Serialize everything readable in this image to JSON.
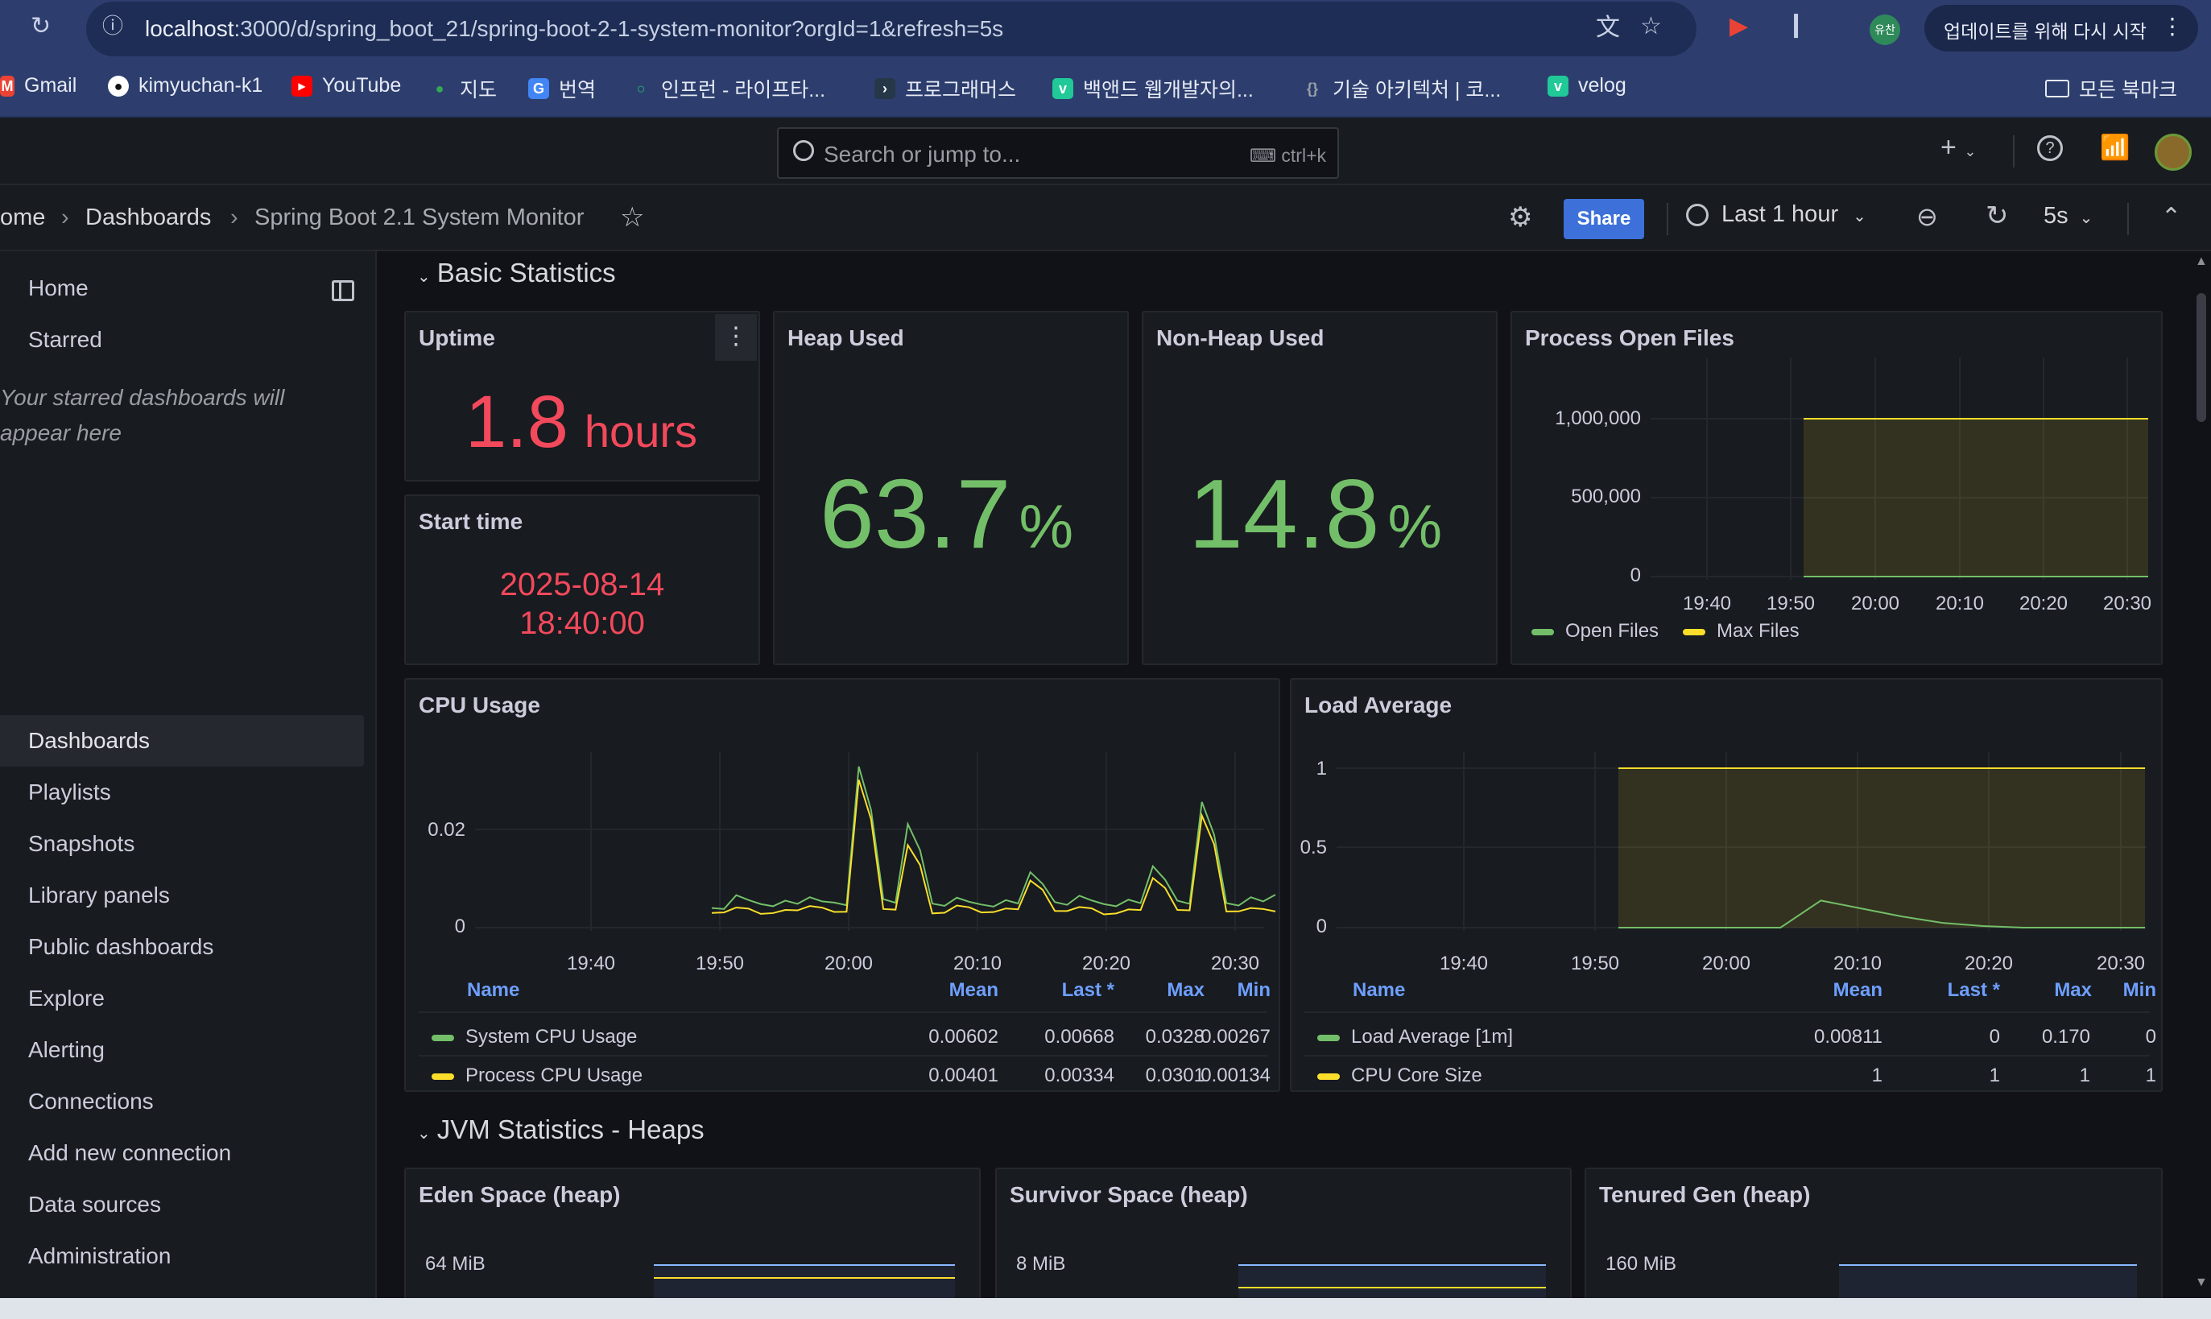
{
  "browser": {
    "url_host": "localhost",
    "url_path": ":3000/d/spring_boot_21/spring-boot-2-1-system-monitor?orgId=1&refresh=5s",
    "profile_label": "유찬",
    "update_label": "업데이트를 위해 다시 시작"
  },
  "bookmarks": [
    {
      "label": "Gmail",
      "color": "#ea4335",
      "icon": "gmail-icon"
    },
    {
      "label": "kimyuchan-k1",
      "color": "#ffffff",
      "icon": "github-icon"
    },
    {
      "label": "YouTube",
      "color": "#ff0000",
      "icon": "youtube-icon"
    },
    {
      "label": "지도",
      "color": "#34a853",
      "icon": "maps-icon"
    },
    {
      "label": "번역",
      "color": "#4285f4",
      "icon": "translate-icon"
    },
    {
      "label": "인프런 - 라이프타...",
      "color": "#1dc078",
      "icon": "inflearn-icon"
    },
    {
      "label": "프로그래머스",
      "color": "#263747",
      "icon": "programmers-icon"
    },
    {
      "label": "백앤드 웹개발자의...",
      "color": "#20c997",
      "icon": "velog-icon"
    },
    {
      "label": "기술 아키텍처 | 코...",
      "color": "#9aa0a6",
      "icon": "code-icon"
    },
    {
      "label": "velog",
      "color": "#20c997",
      "icon": "velog-icon"
    }
  ],
  "bookmarks_folder": "모든 북마크",
  "topnav": {
    "search_placeholder": "Search or jump to...",
    "search_shortcut": "ctrl+k"
  },
  "breadcrumb": {
    "home": "ome",
    "dashboards": "Dashboards",
    "current": "Spring Boot 2.1 System Monitor"
  },
  "toolbar": {
    "share_label": "Share",
    "time_range": "Last 1 hour",
    "refresh_interval": "5s"
  },
  "sidebar": {
    "items": [
      {
        "label": "Home"
      },
      {
        "label": "Starred"
      },
      {
        "label": "Dashboards"
      },
      {
        "label": "Playlists"
      },
      {
        "label": "Snapshots"
      },
      {
        "label": "Library panels"
      },
      {
        "label": "Public dashboards"
      },
      {
        "label": "Explore"
      },
      {
        "label": "Alerting"
      },
      {
        "label": "Connections"
      },
      {
        "label": "Add new connection"
      },
      {
        "label": "Data sources"
      },
      {
        "label": "Administration"
      }
    ],
    "starred_note": "Your starred dashboards will appear here"
  },
  "rows": {
    "basic": "Basic Statistics",
    "jvm_heaps": "JVM Statistics - Heaps"
  },
  "colors": {
    "green": "#73bf69",
    "yellow": "#fade2a",
    "red": "#f2495c",
    "blue": "#8ab8ff"
  },
  "panels": {
    "uptime": {
      "title": "Uptime",
      "value": "1.8",
      "unit": "hours"
    },
    "start_time": {
      "title": "Start time",
      "date": "2025-08-14",
      "time": "18:40:00"
    },
    "heap_used": {
      "title": "Heap Used",
      "value": "63.7",
      "unit": "%"
    },
    "non_heap_used": {
      "title": "Non-Heap Used",
      "value": "14.8",
      "unit": "%"
    },
    "open_files": {
      "title": "Process Open Files",
      "y_ticks": [
        "1,000,000",
        "500,000",
        "0"
      ],
      "x_ticks": [
        "19:40",
        "19:50",
        "20:00",
        "20:10",
        "20:20",
        "20:30"
      ],
      "legend": [
        "Open Files",
        "Max Files"
      ]
    },
    "cpu": {
      "title": "CPU Usage",
      "y_ticks": [
        "0.02",
        "0"
      ],
      "x_ticks": [
        "19:40",
        "19:50",
        "20:00",
        "20:10",
        "20:20",
        "20:30"
      ],
      "table_headers": [
        "Name",
        "Mean",
        "Last *",
        "Max",
        "Min"
      ],
      "rows": [
        {
          "name": "System CPU Usage",
          "mean": "0.00602",
          "last": "0.00668",
          "max": "0.0328",
          "min": "0.00267"
        },
        {
          "name": "Process CPU Usage",
          "mean": "0.00401",
          "last": "0.00334",
          "max": "0.0301",
          "min": "0.00134"
        }
      ]
    },
    "load": {
      "title": "Load Average",
      "y_ticks": [
        "1",
        "0.5",
        "0"
      ],
      "x_ticks": [
        "19:40",
        "19:50",
        "20:00",
        "20:10",
        "20:20",
        "20:30"
      ],
      "table_headers": [
        "Name",
        "Mean",
        "Last *",
        "Max",
        "Min"
      ],
      "rows": [
        {
          "name": "Load Average [1m]",
          "mean": "0.00811",
          "last": "0",
          "max": "0.170",
          "min": "0"
        },
        {
          "name": "CPU Core Size",
          "mean": "1",
          "last": "1",
          "max": "1",
          "min": "1"
        }
      ]
    },
    "eden": {
      "title": "Eden Space (heap)",
      "y_tick": "64 MiB"
    },
    "survivor": {
      "title": "Survivor Space (heap)",
      "y_tick": "8 MiB"
    },
    "tenured": {
      "title": "Tenured Gen (heap)",
      "y_tick": "160 MiB"
    }
  },
  "chart_data": [
    {
      "type": "area",
      "title": "Process Open Files",
      "x": [
        "19:53",
        "20:33"
      ],
      "series": [
        {
          "name": "Open Files",
          "values": [
            0,
            0
          ]
        },
        {
          "name": "Max Files",
          "values": [
            1048576,
            1048576
          ]
        }
      ],
      "ylim": [
        0,
        1048576
      ]
    },
    {
      "type": "line",
      "title": "CPU Usage",
      "x": [
        "19:53",
        "20:33"
      ],
      "series": [
        {
          "name": "System CPU Usage",
          "values": [
            0.004,
            0.0066,
            0.0048,
            0.0055,
            0.0062,
            0.0051,
            0.0328,
            0.0058,
            0.0211,
            0.0049,
            0.0061,
            0.0047,
            0.0056,
            0.0113,
            0.0052,
            0.0065,
            0.0048,
            0.0057,
            0.0125,
            0.0055,
            0.0256,
            0.005,
            0.0062,
            0.0067
          ]
        },
        {
          "name": "Process CPU Usage",
          "values": [
            0.003,
            0.0041,
            0.0028,
            0.0036,
            0.0044,
            0.0032,
            0.0301,
            0.0038,
            0.0168,
            0.0029,
            0.0045,
            0.0031,
            0.0039,
            0.0096,
            0.0034,
            0.0042,
            0.0027,
            0.0037,
            0.0101,
            0.0036,
            0.0228,
            0.0033,
            0.004,
            0.0033
          ]
        }
      ],
      "ylim": [
        0,
        0.034
      ]
    },
    {
      "type": "area",
      "title": "Load Average",
      "x": [
        "19:53",
        "20:33"
      ],
      "series": [
        {
          "name": "Load Average [1m]",
          "values": [
            0,
            0,
            0,
            0,
            0,
            0.17,
            0.12,
            0.07,
            0.03,
            0.01,
            0,
            0,
            0,
            0
          ]
        },
        {
          "name": "CPU Core Size",
          "values": [
            1,
            1,
            1,
            1,
            1,
            1,
            1,
            1,
            1,
            1,
            1,
            1,
            1,
            1
          ]
        }
      ],
      "ylim": [
        0,
        1
      ]
    }
  ]
}
